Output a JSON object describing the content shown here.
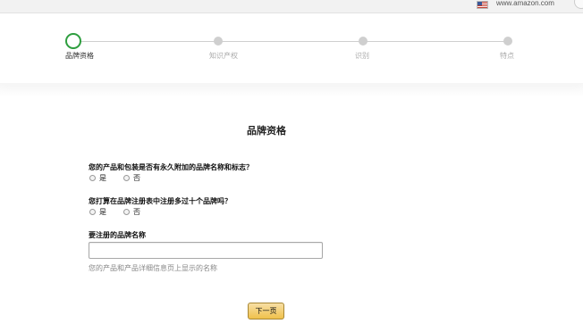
{
  "browser": {
    "domain": "www.amazon.com",
    "flag_icon": "us-flag-icon"
  },
  "steps": [
    {
      "label": "品牌资格",
      "active": true
    },
    {
      "label": "知识产权",
      "active": false
    },
    {
      "label": "识别",
      "active": false
    },
    {
      "label": "特点",
      "active": false
    }
  ],
  "form": {
    "title": "品牌资格",
    "q1": {
      "label": "您的产品和包装是否有永久附加的品牌名称和标志？",
      "yes": "是",
      "no": "否"
    },
    "q2": {
      "label": "您打算在品牌注册表中注册多过十个品牌吗？",
      "yes": "是",
      "no": "否"
    },
    "brand_name": {
      "label": "要注册的品牌名称",
      "value": "",
      "hint": "您的产品和产品详细信息页上显示的名称"
    },
    "next_label": "下一页"
  },
  "colors": {
    "active_step": "#2e9e3f",
    "inactive_step": "#cfcfcf",
    "button": "#f0c14b"
  }
}
